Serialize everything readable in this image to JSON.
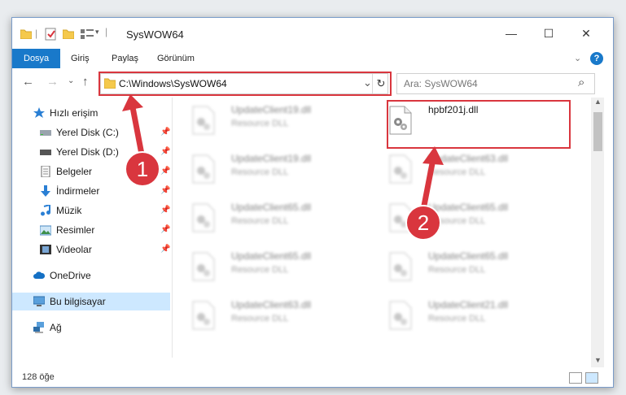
{
  "window": {
    "title": "SysWOW64"
  },
  "controls": {
    "minimize": "—",
    "maximize": "☐",
    "close": "✕"
  },
  "ribbon": {
    "tabs": [
      "Dosya",
      "Giriş",
      "Paylaş",
      "Görünüm"
    ],
    "collapse": "⌄",
    "help": "?"
  },
  "address": {
    "path": "C:\\Windows\\SysWOW64",
    "refresh": "↻",
    "dropdown": "⌄"
  },
  "search": {
    "placeholder": "Ara: SysWOW64",
    "icon": "⌕"
  },
  "nav": {
    "back": "←",
    "forward": "→",
    "recent": "⌄",
    "up": "↑",
    "items": [
      {
        "label": "Hızlı erişim",
        "icon": "star-icon",
        "pinned": false
      },
      {
        "label": "Yerel Disk (C:)",
        "icon": "drive-icon",
        "pinned": true
      },
      {
        "label": "Yerel Disk (D:)",
        "icon": "drive-icon",
        "pinned": true
      },
      {
        "label": "Belgeler",
        "icon": "documents-icon",
        "pinned": true
      },
      {
        "label": "İndirmeler",
        "icon": "download-icon",
        "pinned": true
      },
      {
        "label": "Müzik",
        "icon": "music-icon",
        "pinned": true
      },
      {
        "label": "Resimler",
        "icon": "pictures-icon",
        "pinned": true
      },
      {
        "label": "Videolar",
        "icon": "videos-icon",
        "pinned": true
      },
      {
        "label": "OneDrive",
        "icon": "cloud-icon",
        "pinned": false
      },
      {
        "label": "Bu bilgisayar",
        "icon": "computer-icon",
        "pinned": false
      },
      {
        "label": "Ağ",
        "icon": "network-icon",
        "pinned": false
      }
    ]
  },
  "files": [
    {
      "name": "UpdateClient19.dll",
      "type": "Resource DLL",
      "blurred": true
    },
    {
      "name": "hpbf201j.dll",
      "type": "",
      "blurred": false
    },
    {
      "name": "UpdateClient19.dll",
      "type": "Resource DLL",
      "blurred": true
    },
    {
      "name": "UpdateClient63.dll",
      "type": "Resource DLL",
      "blurred": true
    },
    {
      "name": "UpdateClient65.dll",
      "type": "Resource DLL",
      "blurred": true
    },
    {
      "name": "UpdateClient65.dll",
      "type": "Resource DLL",
      "blurred": true
    },
    {
      "name": "UpdateClient65.dll",
      "type": "Resource DLL",
      "blurred": true
    },
    {
      "name": "UpdateClient65.dll",
      "type": "Resource DLL",
      "blurred": true
    },
    {
      "name": "UpdateClient63.dll",
      "type": "Resource DLL",
      "blurred": true
    },
    {
      "name": "UpdateClient21.dll",
      "type": "Resource DLL",
      "blurred": true
    }
  ],
  "status": {
    "count": "128 öğe"
  },
  "callouts": [
    "1",
    "2"
  ],
  "colors": {
    "accent": "#1979ca",
    "highlight": "#d9363e",
    "selected": "#cde8ff"
  }
}
